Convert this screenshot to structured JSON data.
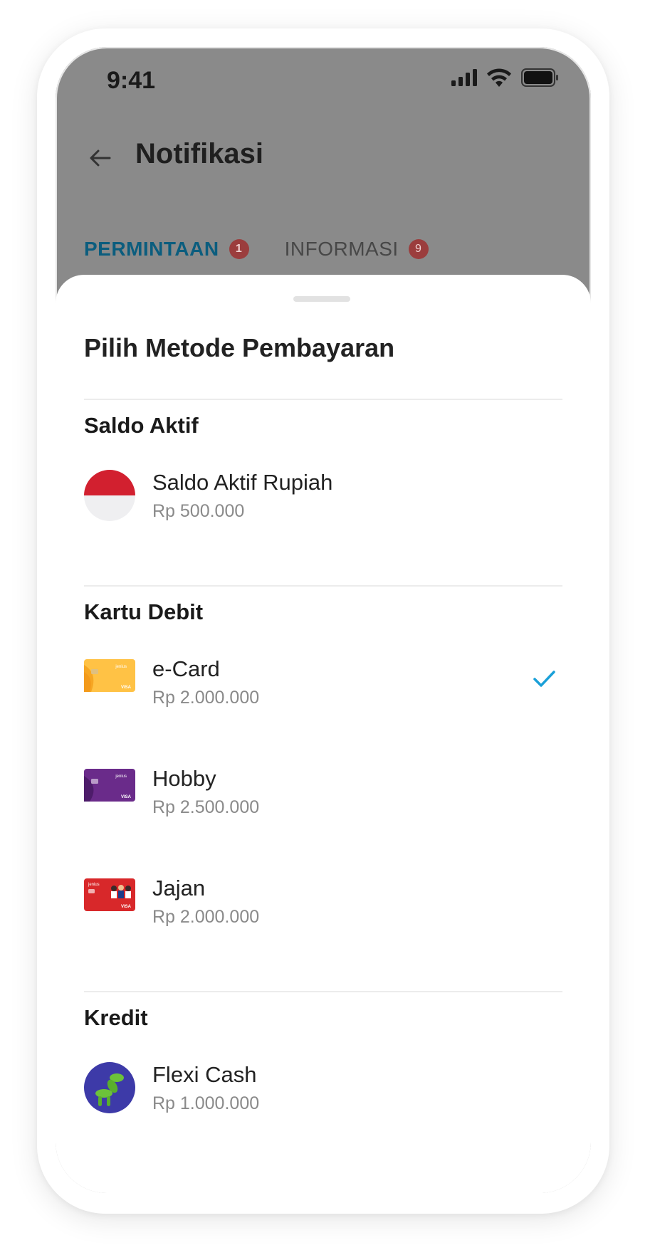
{
  "status_bar": {
    "time": "9:41"
  },
  "header": {
    "title": "Notifikasi"
  },
  "tabs": [
    {
      "label": "PERMINTAAN",
      "badge": "1",
      "active": true
    },
    {
      "label": "INFORMASI",
      "badge": "9",
      "active": false
    }
  ],
  "sheet": {
    "title": "Pilih Metode Pembayaran",
    "sections": [
      {
        "title": "Saldo Aktif",
        "items": [
          {
            "name": "Saldo Aktif Rupiah",
            "amount": "Rp 500.000",
            "icon": "indonesia-flag-icon"
          }
        ]
      },
      {
        "title": "Kartu Debit",
        "items": [
          {
            "name": "e-Card",
            "amount": "Rp 2.000.000",
            "icon": "ecard-yellow-icon",
            "selected": true
          },
          {
            "name": "Hobby",
            "amount": "Rp 2.500.000",
            "icon": "hobby-purple-card-icon"
          },
          {
            "name": "Jajan",
            "amount": "Rp 2.000.000",
            "icon": "jajan-red-card-icon"
          }
        ]
      },
      {
        "title": "Kredit",
        "items": [
          {
            "name": "Flexi Cash",
            "amount": "Rp 1.000.000",
            "icon": "flexi-cash-icon"
          }
        ]
      }
    ]
  },
  "colors": {
    "accent": "#1aa0d8",
    "tab_active": "#0b5d7e",
    "badge": "#9b3d3d"
  }
}
